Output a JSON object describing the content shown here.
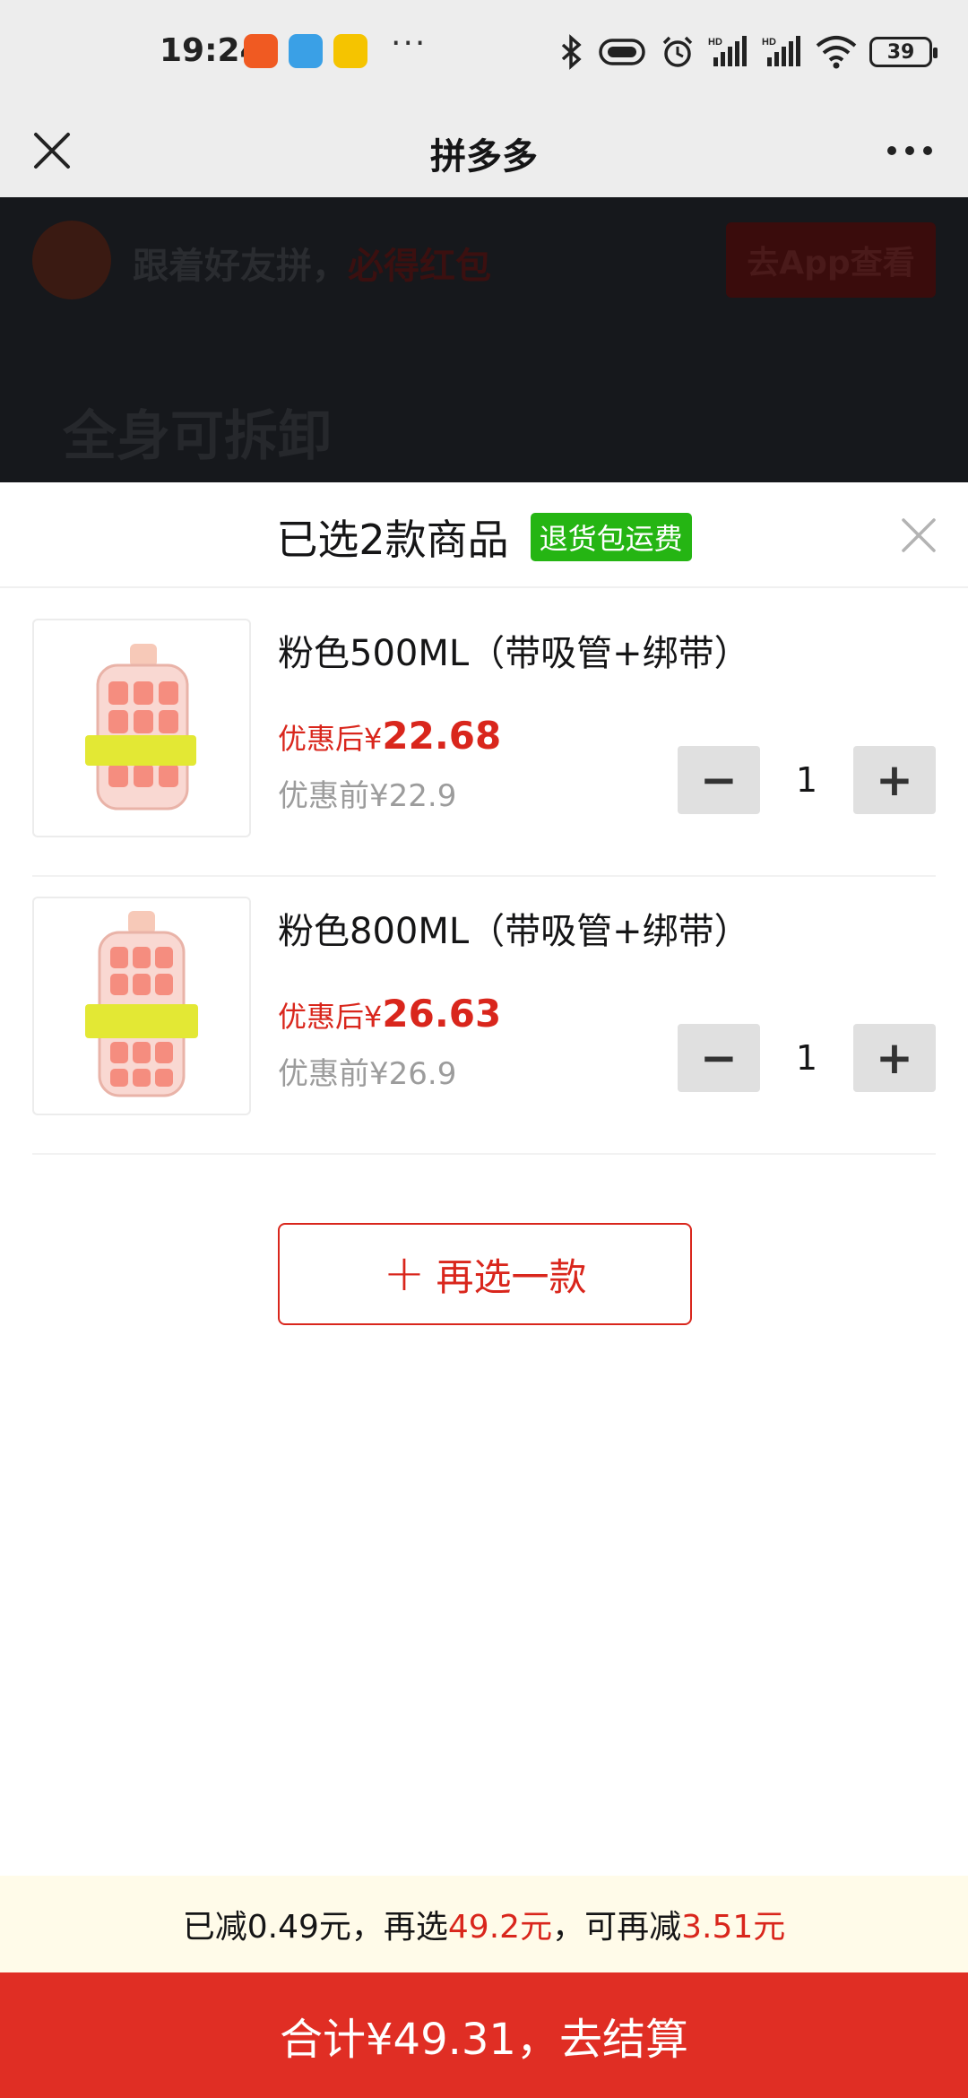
{
  "status_bar": {
    "time": "19:24",
    "battery": "39",
    "icons": [
      "app-notification-icon-orange",
      "app-notification-icon-blue",
      "app-notification-icon-yellow",
      "more-dots",
      "bluetooth-icon",
      "vibrate-icon",
      "alarm-icon",
      "signal-hd-icon",
      "signal-hd-icon-2",
      "wifi-icon"
    ]
  },
  "navbar": {
    "title": "拼多多",
    "close_icon": "close-icon",
    "more_icon": "more-icon"
  },
  "background_page": {
    "invite_text_prefix": "跟着好友拼，",
    "invite_text_highlight": "必得红包",
    "open_app_button": "去App查看",
    "headline": "全身可拆卸"
  },
  "sheet": {
    "title": "已选2款商品",
    "badge": "退货包运费",
    "items": [
      {
        "name": "粉色500ML（带吸管+绑带）",
        "price_after_label": "优惠后¥",
        "price_after": "22.68",
        "price_before": "优惠前¥22.9",
        "quantity": "1",
        "minus": "−",
        "plus": "+"
      },
      {
        "name": "粉色800ML（带吸管+绑带）",
        "price_after_label": "优惠后¥",
        "price_after": "26.63",
        "price_before": "优惠前¥26.9",
        "quantity": "1",
        "minus": "−",
        "plus": "+"
      }
    ],
    "add_more_label": "再选一款",
    "add_more_plus": "+"
  },
  "promo": {
    "part1": "已减0.49元，再选",
    "amount1": "49.2元",
    "part2": "，可再减",
    "amount2": "3.51元"
  },
  "checkout_label": "合计¥49.31，去结算",
  "colors": {
    "accent_red": "#e02e24",
    "price_red": "#d9261c",
    "badge_green": "#25b513"
  }
}
